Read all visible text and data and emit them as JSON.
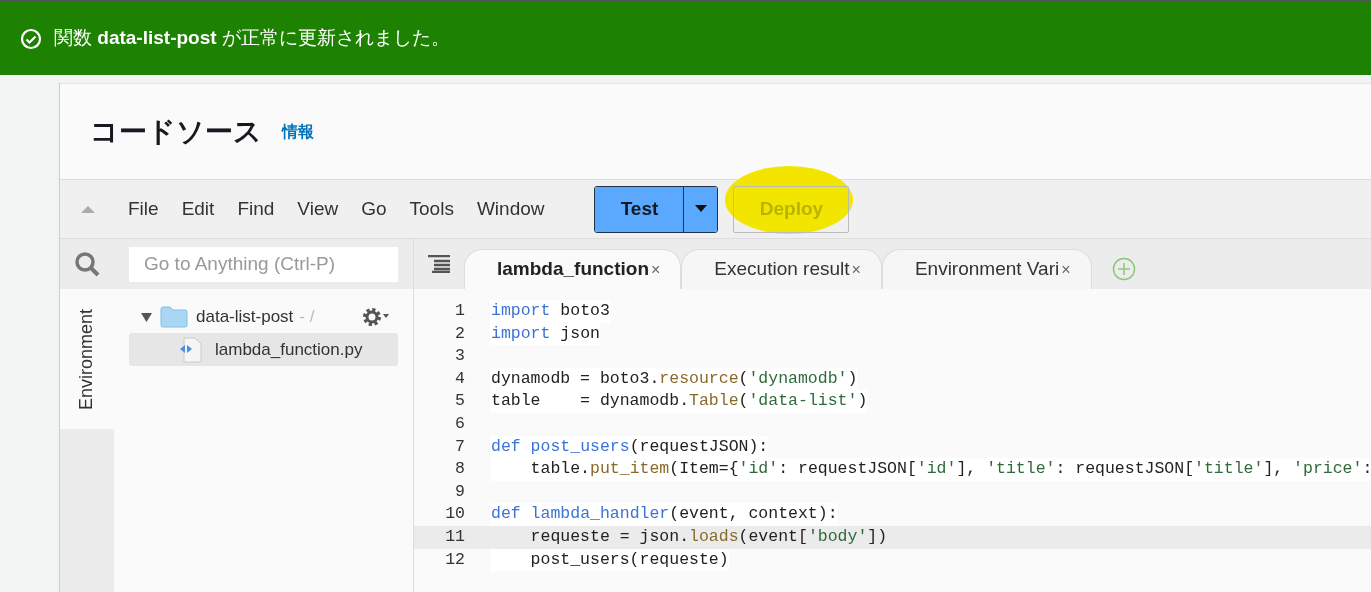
{
  "banner": {
    "message": "関数 **data-list-post** が正常に更新されました。"
  },
  "section": {
    "title": "コードソース",
    "info_link": "情報"
  },
  "menu": [
    "File",
    "Edit",
    "Find",
    "View",
    "Go",
    "Tools",
    "Window"
  ],
  "buttons": {
    "test": "Test",
    "deploy": "Deploy",
    "deploy_disabled": true,
    "deploy_highlighted": true
  },
  "search": {
    "placeholder": "Go to Anything (Ctrl-P)"
  },
  "side_tab": "Environment",
  "tree": [
    {
      "name": "data-list-post",
      "suffix": "- /",
      "expanded": true,
      "selected": false,
      "children": [
        {
          "name": "lambda_function.py",
          "selected": true
        }
      ]
    }
  ],
  "tabs": [
    {
      "label": "lambda_function",
      "close": "×",
      "selected": true
    },
    {
      "label": "Execution result",
      "close": "×",
      "selected": false
    },
    {
      "label": "Environment Vari",
      "close": "×",
      "selected": false
    }
  ],
  "code": [
    {
      "number": "1",
      "current": false,
      "tokens": [
        {
          "kind": "keyword",
          "t": "import"
        },
        {
          "kind": "plain",
          "t": " boto3"
        }
      ]
    },
    {
      "number": "2",
      "current": false,
      "tokens": [
        {
          "kind": "keyword",
          "t": "import"
        },
        {
          "kind": "plain",
          "t": " json"
        }
      ]
    },
    {
      "number": "3",
      "current": false
    },
    {
      "number": "4",
      "current": false,
      "tokens": [
        {
          "kind": "plain",
          "t": "dynamodb = boto3."
        },
        {
          "kind": "method",
          "t": "resource"
        },
        {
          "kind": "plain",
          "t": "("
        },
        {
          "kind": "string",
          "t": "'dynamodb'"
        },
        {
          "kind": "plain",
          "t": ")"
        }
      ]
    },
    {
      "number": "5",
      "current": false,
      "tokens": [
        {
          "kind": "plain",
          "t": "table    = dynamodb."
        },
        {
          "kind": "method",
          "t": "Table"
        },
        {
          "kind": "plain",
          "t": "("
        },
        {
          "kind": "string",
          "t": "'data-list'"
        },
        {
          "kind": "plain",
          "t": ")"
        }
      ]
    },
    {
      "number": "6",
      "current": false
    },
    {
      "number": "7",
      "current": false,
      "tokens": [
        {
          "kind": "keyword",
          "t": "def"
        },
        {
          "kind": "function",
          "t": " post_users"
        },
        {
          "kind": "plain",
          "t": "(requestJSON):"
        }
      ]
    },
    {
      "number": "8",
      "current": false,
      "tokens": [
        {
          "kind": "plain",
          "t": "    table."
        },
        {
          "kind": "method",
          "t": "put_item"
        },
        {
          "kind": "plain",
          "t": "(Item={"
        },
        {
          "kind": "string",
          "t": "'id'"
        },
        {
          "kind": "plain",
          "t": ": requestJSON["
        },
        {
          "kind": "string",
          "t": "'id'"
        },
        {
          "kind": "plain",
          "t": "], "
        },
        {
          "kind": "string",
          "t": "'title'"
        },
        {
          "kind": "plain",
          "t": ": requestJSON["
        },
        {
          "kind": "string",
          "t": "'title'"
        },
        {
          "kind": "plain",
          "t": "], "
        },
        {
          "kind": "string",
          "t": "'price'"
        },
        {
          "kind": "plain",
          "t": ":"
        }
      ]
    },
    {
      "number": "9",
      "current": false
    },
    {
      "number": "10",
      "current": false,
      "tokens": [
        {
          "kind": "keyword",
          "t": "def"
        },
        {
          "kind": "function",
          "t": " lambda_handler"
        },
        {
          "kind": "plain",
          "t": "(event, context):"
        }
      ]
    },
    {
      "number": "11",
      "current": true,
      "tokens": [
        {
          "kind": "plain",
          "t": "    requeste = json."
        },
        {
          "kind": "method",
          "t": "loads"
        },
        {
          "kind": "plain",
          "t": "(event["
        },
        {
          "kind": "string",
          "t": "'body'"
        },
        {
          "kind": "plain",
          "t": "])"
        }
      ]
    },
    {
      "number": "12",
      "current": false,
      "tokens": [
        {
          "kind": "plain",
          "t": "    post_users(requeste)"
        }
      ]
    }
  ]
}
